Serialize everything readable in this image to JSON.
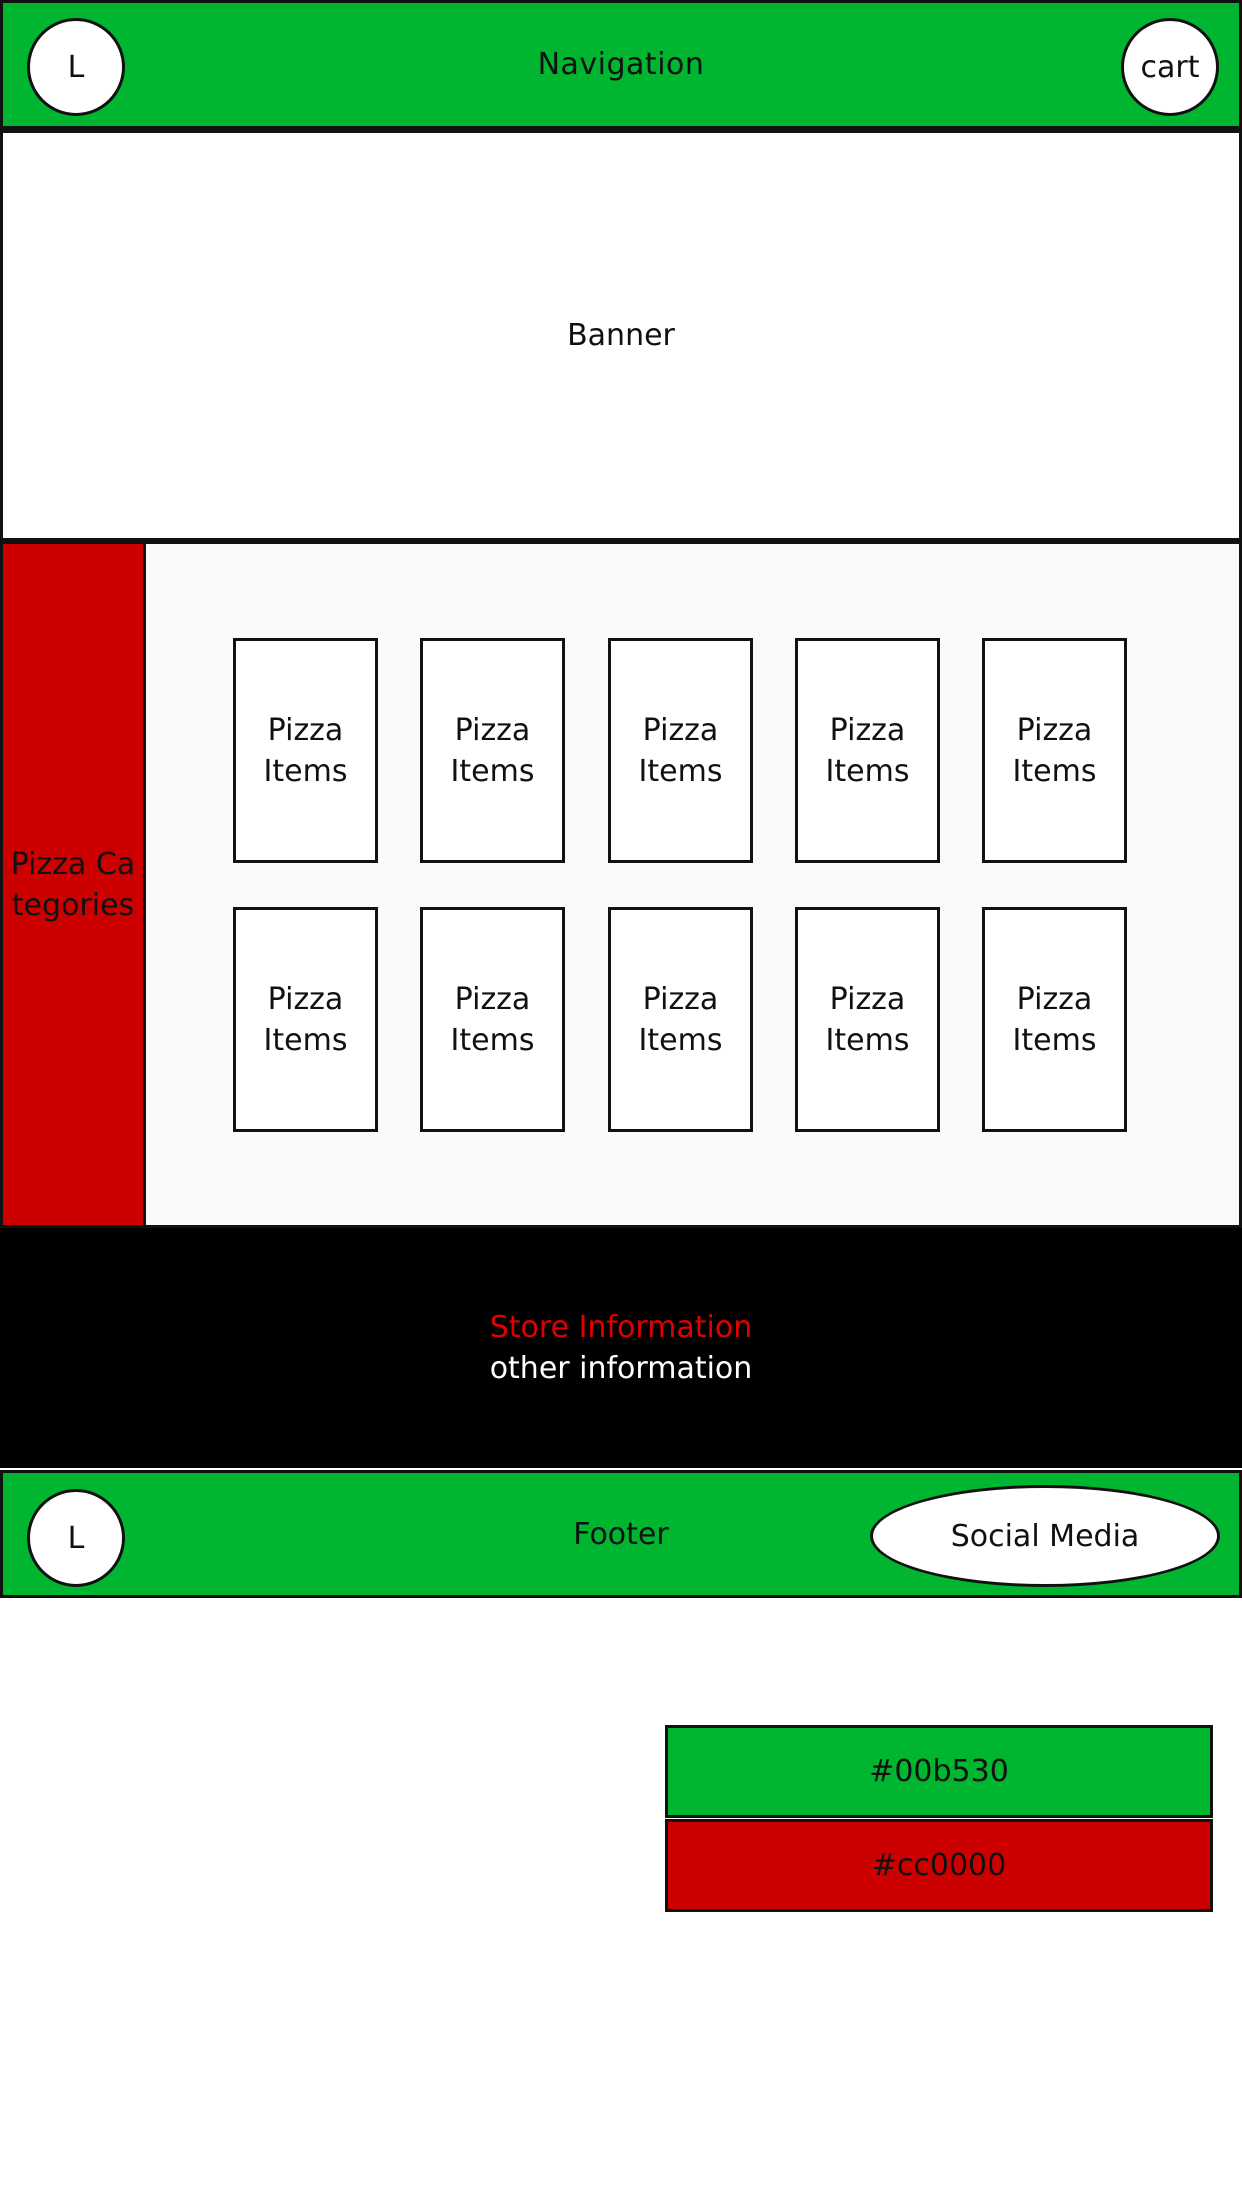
{
  "nav": {
    "logo": "L",
    "title": "Navigation",
    "cart": "cart"
  },
  "banner": {
    "label": "Banner"
  },
  "sidebar": {
    "label": "Pizza Categories"
  },
  "products": {
    "items": [
      "Pizza Items",
      "Pizza Items",
      "Pizza Items",
      "Pizza Items",
      "Pizza Items",
      "Pizza Items",
      "Pizza Items",
      "Pizza Items",
      "Pizza Items",
      "Pizza Items"
    ]
  },
  "info": {
    "store": "Store Information",
    "other": "other information"
  },
  "footer": {
    "logo": "L",
    "title": "Footer",
    "social": "Social Media"
  },
  "swatches": [
    {
      "label": "#00b530",
      "color": "#00b530"
    },
    {
      "label": "#cc0000",
      "color": "#cc0000"
    }
  ]
}
